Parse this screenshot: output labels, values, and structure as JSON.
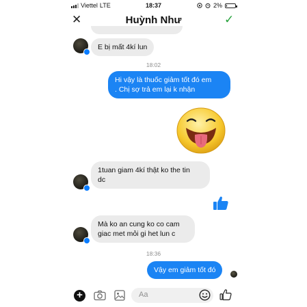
{
  "status": {
    "carrier": "Viettel",
    "network": "LTE",
    "time": "18:37",
    "battery_percent": "2%",
    "battery_level": 0.02
  },
  "header": {
    "title": "Huỳnh Như",
    "close_icon": "close-icon",
    "confirm_icon": "checkmark-icon"
  },
  "messages": [
    {
      "from": "them",
      "text": "E bị mất 4kí lun"
    },
    {
      "type": "timestamp",
      "text": "18:02"
    },
    {
      "from": "me",
      "lines": [
        "Hi vậy là thuốc giảm tốt đó em",
        ". Chị sợ trả em lại k nhận"
      ]
    },
    {
      "from": "me",
      "type": "sticker",
      "sticker": "tongue-out-emoji"
    },
    {
      "from": "them",
      "lines": [
        "1tuan giam 4kí thật ko the tin",
        "dc"
      ]
    },
    {
      "from": "me",
      "type": "like",
      "icon": "thumbs-up-icon"
    },
    {
      "from": "them",
      "lines": [
        "Mà ko an cung ko co cam",
        "giac met mỏi gi het lun c"
      ]
    },
    {
      "type": "timestamp",
      "text": "18:36"
    },
    {
      "from": "me",
      "text": "Vậy em giảm tốt đó"
    }
  ],
  "composer": {
    "placeholder": "Aa"
  },
  "colors": {
    "outgoing": "#1b84f4",
    "incoming": "#ebebeb",
    "confirm": "#25a13a",
    "like": "#1b84f4"
  }
}
